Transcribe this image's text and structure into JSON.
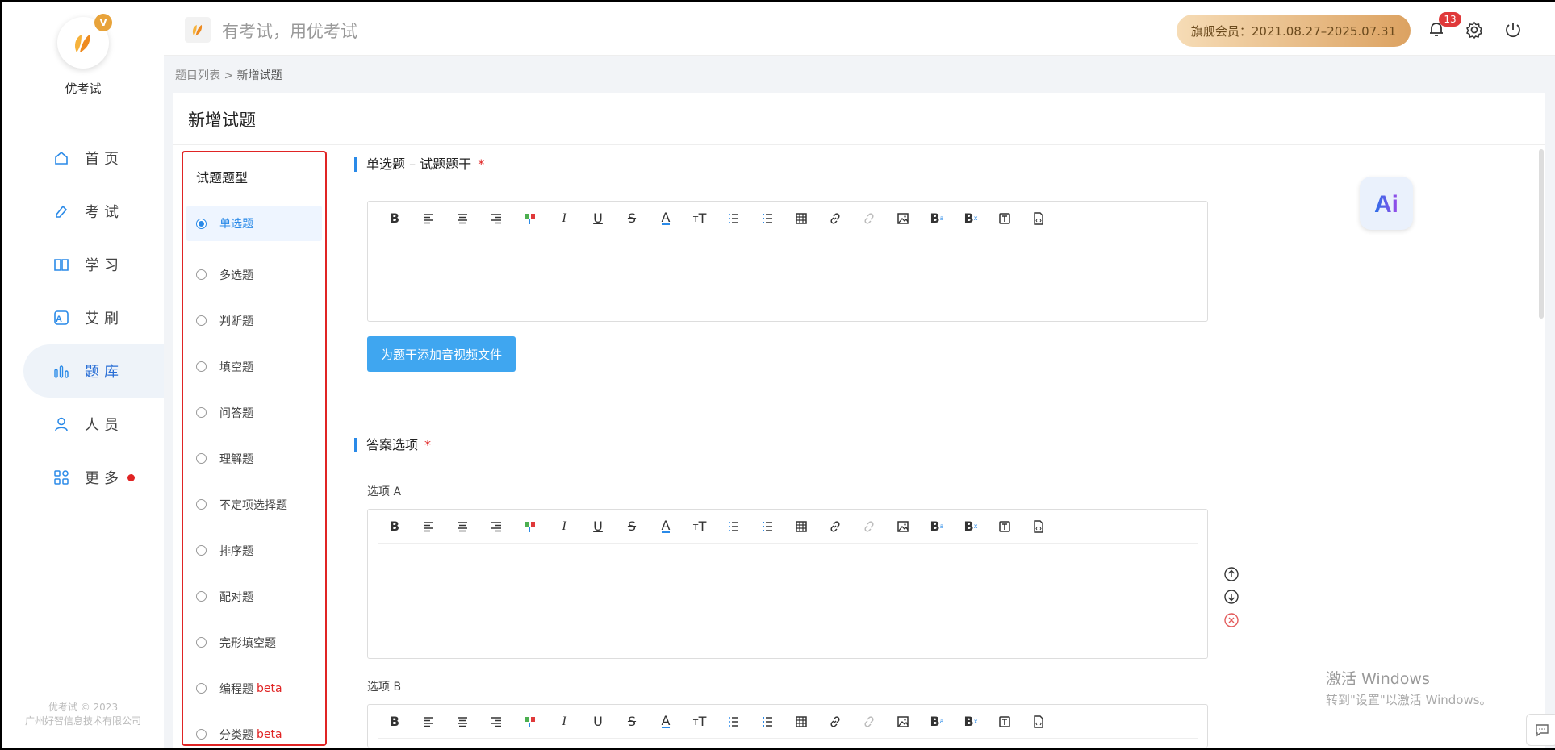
{
  "app": {
    "name": "优考试",
    "logo_badge": "V",
    "slogan": "有考试，用优考试"
  },
  "sidebar": {
    "items": [
      {
        "label": "首页",
        "icon": "home-icon"
      },
      {
        "label": "考试",
        "icon": "pencil-icon"
      },
      {
        "label": "学习",
        "icon": "book-icon"
      },
      {
        "label": "艾刷",
        "icon": "letter-a-icon"
      },
      {
        "label": "题库",
        "icon": "bars-icon",
        "active": true
      },
      {
        "label": "人员",
        "icon": "user-icon"
      },
      {
        "label": "更多",
        "icon": "grid-icon",
        "red_dot": true
      }
    ],
    "footer_line1": "优考试 © 2023",
    "footer_line2": "广州好智信息技术有限公司"
  },
  "topbar": {
    "member_text": "旗舰会员：2021.08.27–2025.07.31",
    "notification_count": "13"
  },
  "breadcrumb": {
    "parent": "题目列表",
    "separator": " > ",
    "current": "新增试题"
  },
  "page": {
    "title": "新增试题"
  },
  "question_types": {
    "title": "试题题型",
    "items": [
      {
        "label": "单选题",
        "active": true
      },
      {
        "label": "多选题"
      },
      {
        "label": "判断题"
      },
      {
        "label": "填空题"
      },
      {
        "label": "问答题"
      },
      {
        "label": "理解题"
      },
      {
        "label": "不定项选择题"
      },
      {
        "label": "排序题"
      },
      {
        "label": "配对题"
      },
      {
        "label": "完形填空题"
      },
      {
        "label": "编程题",
        "beta": "beta"
      },
      {
        "label": "分类题",
        "beta": "beta"
      }
    ]
  },
  "stem": {
    "heading": "单选题 – 试题题干",
    "required": "*",
    "media_button": "为题干添加音视频文件"
  },
  "answers": {
    "heading": "答案选项",
    "required": "*",
    "option_a": "选项 A",
    "option_b": "选项 B"
  },
  "toolbar_tools": [
    "B",
    "align-left",
    "align-center",
    "align-right",
    "format-painter",
    "I",
    "U",
    "S",
    "A",
    "TT",
    "ordered-list",
    "bullet-list",
    "table",
    "link",
    "unlink",
    "image",
    "superscript",
    "subscript",
    "text-box",
    "file-code"
  ],
  "ai_label": "Ai",
  "watermark": {
    "line1": "激活 Windows",
    "line2": "转到\"设置\"以激活 Windows。"
  },
  "colors": {
    "accent": "#2a8ae8",
    "danger": "#e02424",
    "button": "#3fa6f0"
  }
}
